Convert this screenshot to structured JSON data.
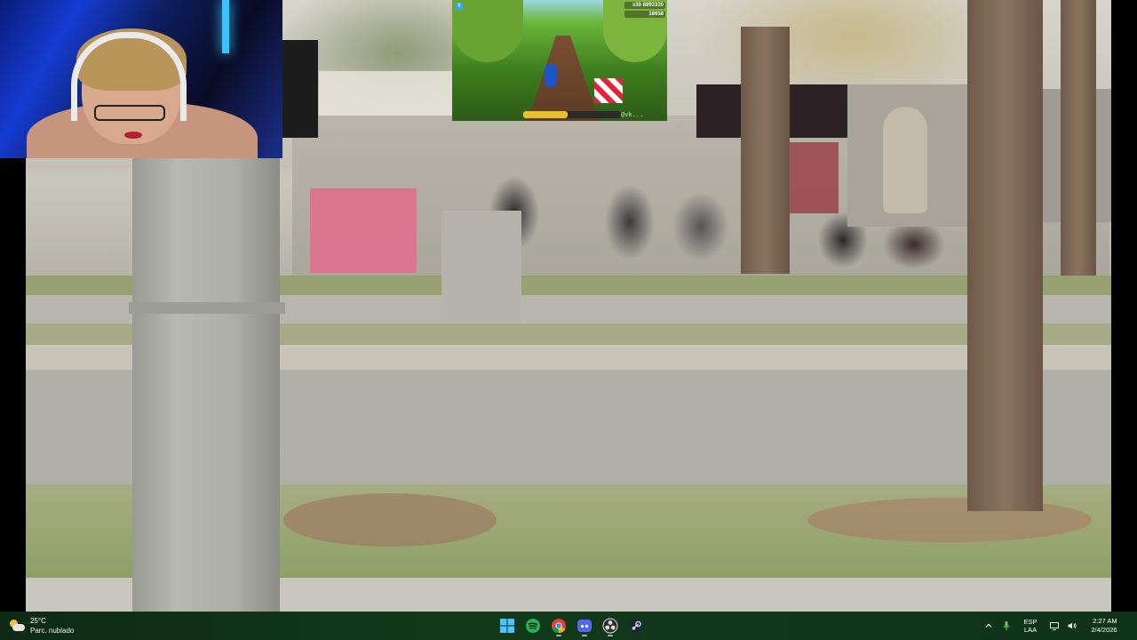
{
  "taskbar": {
    "weather": {
      "temperature": "25°C",
      "condition": "Parc. nublado",
      "icon": "partly-cloudy-icon"
    },
    "pinned_apps": [
      {
        "name": "start",
        "icon": "windows-start-icon"
      },
      {
        "name": "spotify",
        "icon": "spotify-icon"
      },
      {
        "name": "chrome",
        "icon": "chrome-icon"
      },
      {
        "name": "discord",
        "icon": "discord-icon"
      },
      {
        "name": "obs",
        "icon": "obs-studio-icon"
      },
      {
        "name": "steam",
        "icon": "steam-icon"
      }
    ],
    "tray": {
      "language": "ESP",
      "layout": "LAA",
      "time": "2:27 AM",
      "date": "2/4/2026",
      "icons": [
        "chevron-up-icon",
        "microphone-icon",
        "network-icon",
        "volume-icon"
      ]
    }
  },
  "stream_overlay": {
    "webcam": {
      "present": true
    },
    "game": {
      "score": "8993320",
      "coins": "18658",
      "multiplier": "x30",
      "handle": "@vk...",
      "power_level": 0.45
    }
  },
  "colors": {
    "taskbar_bg": "#0f3318",
    "spotify": "#1db954",
    "discord": "#5865f2"
  }
}
